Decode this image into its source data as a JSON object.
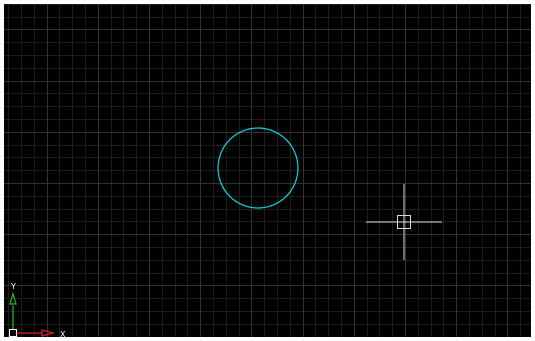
{
  "viewport": {
    "background": "#000000",
    "grid_minor_color": "#1e1e1e",
    "grid_major_color": "#333333"
  },
  "drawing": {
    "circle": {
      "stroke_color": "#00d8e6"
    },
    "crosshair": {
      "color": "#d9d9d9"
    }
  },
  "ucs": {
    "x_label": "X",
    "y_label": "Y",
    "x_color": "#e02020",
    "y_color": "#20c020",
    "origin_color": "#ffffff"
  }
}
